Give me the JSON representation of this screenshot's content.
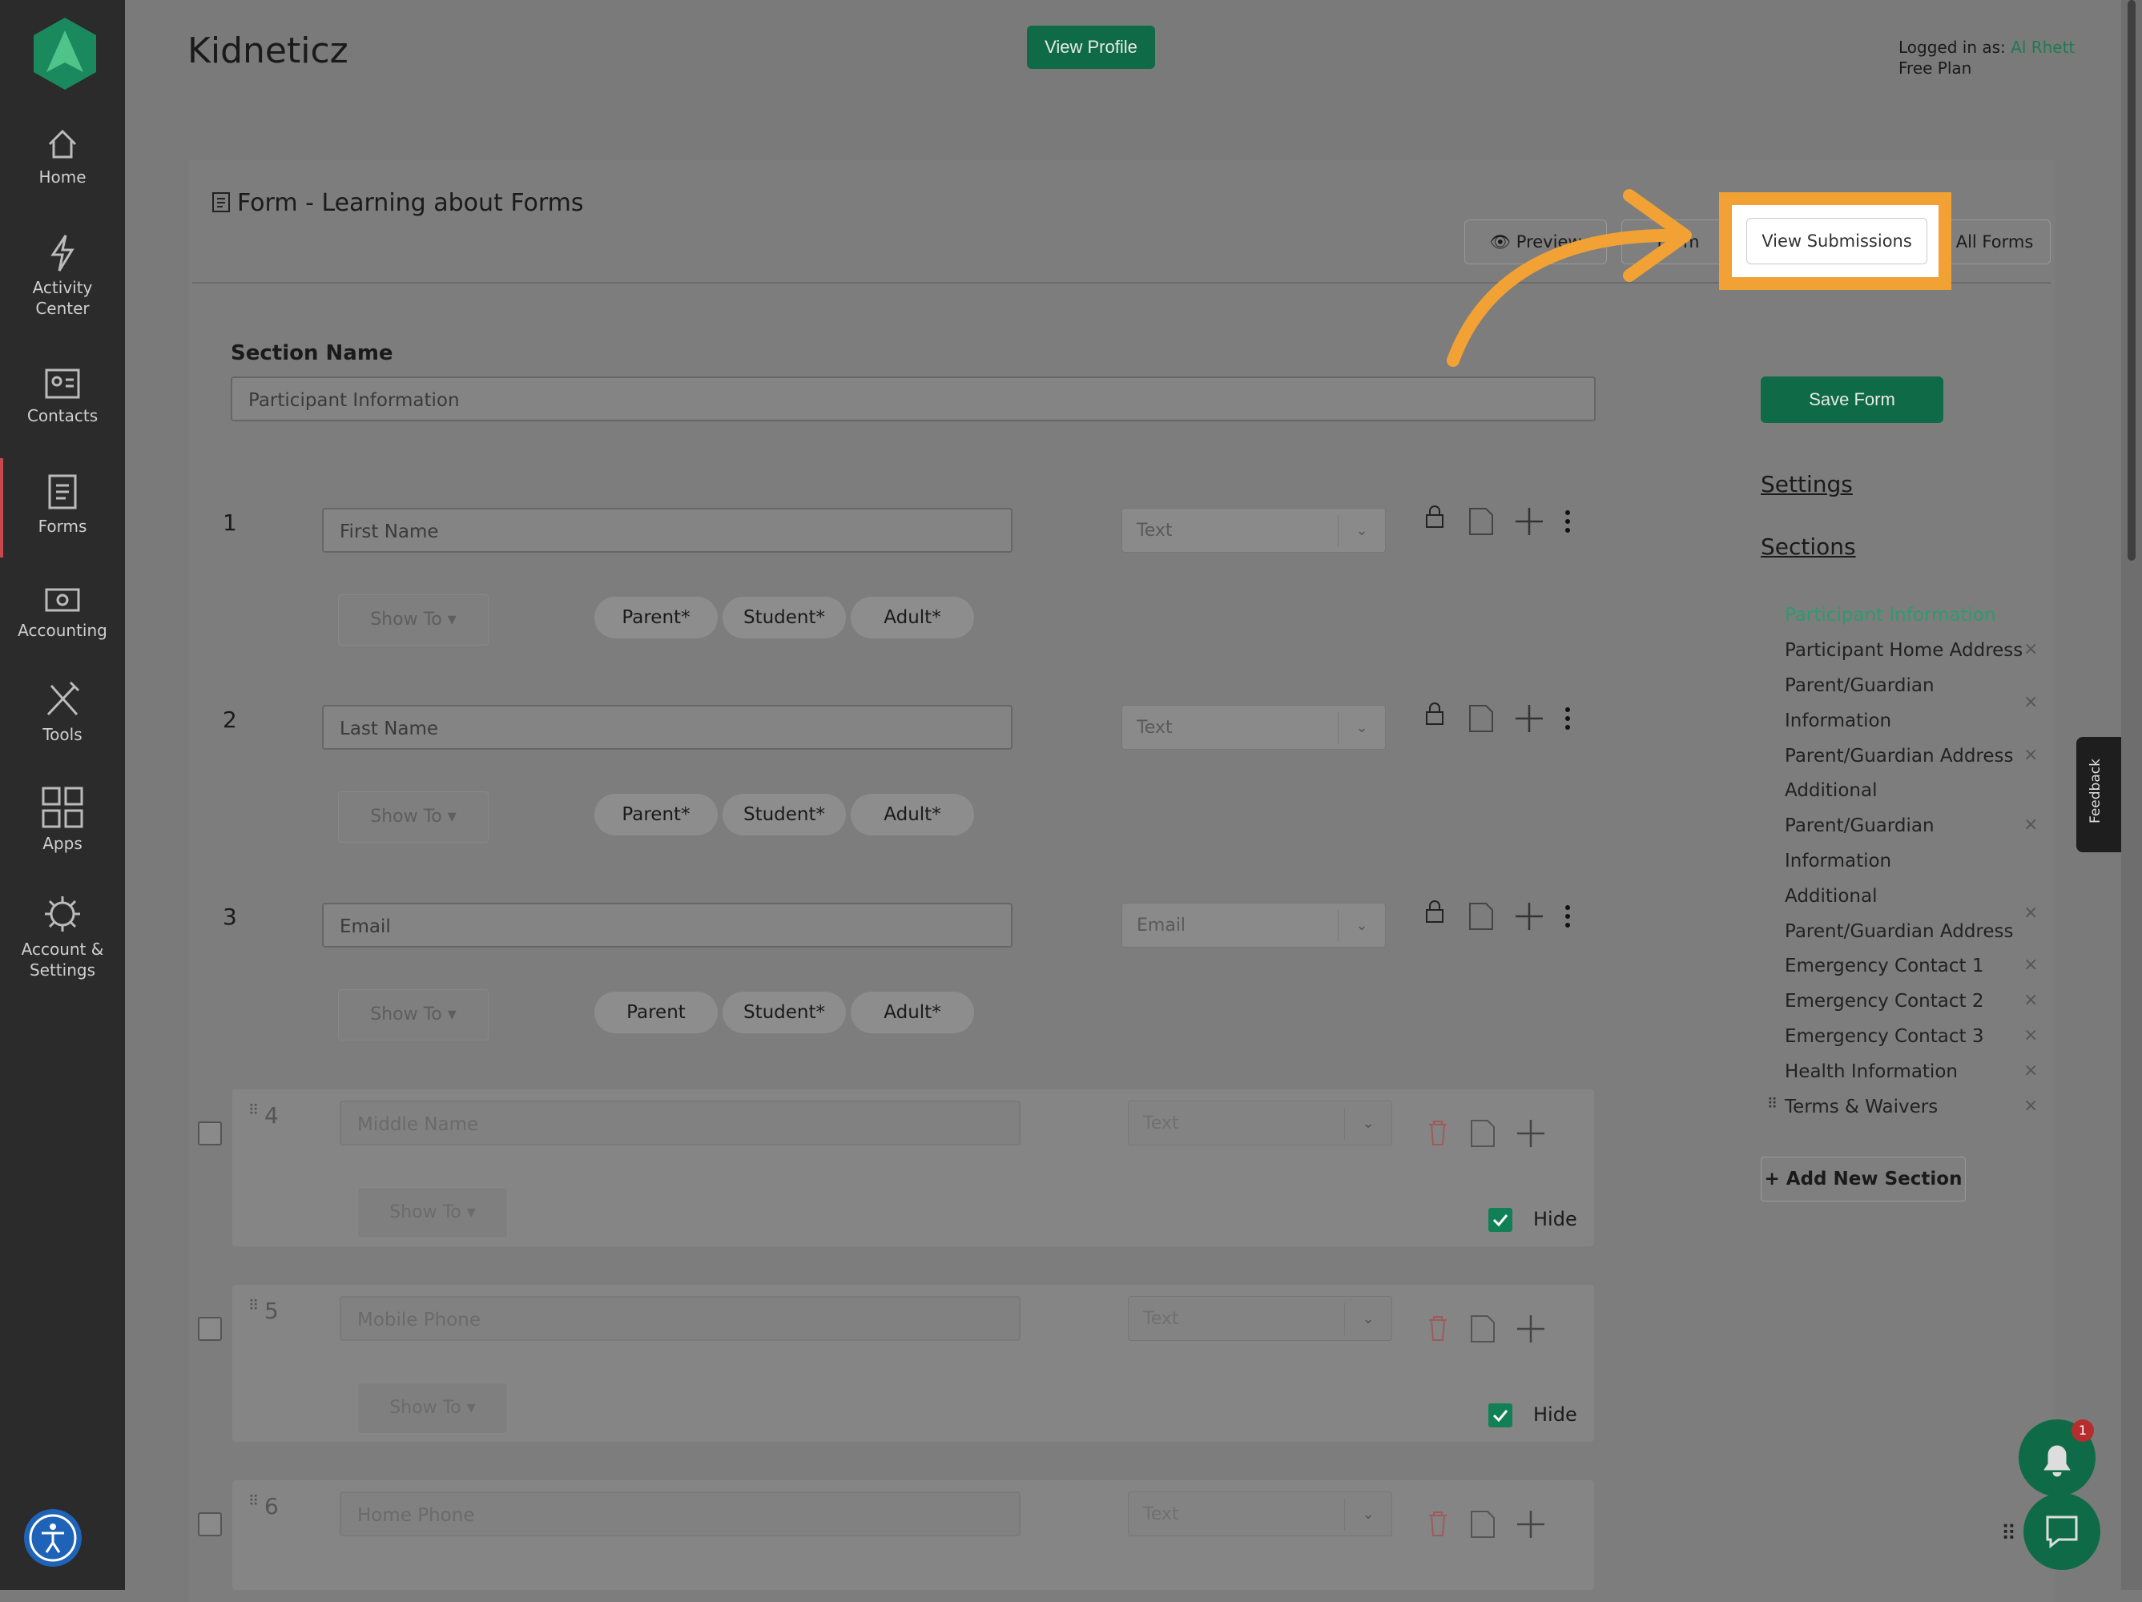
{
  "app": {
    "title": "Kidneticz",
    "view_profile": "View Profile",
    "logged_in_prefix": "Logged in as:",
    "user": "Al Rhett",
    "plan": "Free Plan"
  },
  "nav": [
    {
      "label": "Home",
      "icon": "home-icon"
    },
    {
      "label": "Activity Center",
      "icon": "lightning-icon"
    },
    {
      "label": "Contacts",
      "icon": "contacts-icon"
    },
    {
      "label": "Forms",
      "icon": "clipboard-icon"
    },
    {
      "label": "Accounting",
      "icon": "money-icon"
    },
    {
      "label": "Tools",
      "icon": "tools-icon"
    },
    {
      "label": "Apps",
      "icon": "grid-icon"
    },
    {
      "label": "Account & Settings",
      "icon": "gear-icon"
    }
  ],
  "form": {
    "title": "Form - Learning about Forms",
    "toolbar": {
      "preview": "Preview",
      "form": "Form",
      "view_submissions": "View Submissions",
      "all_forms": "All Forms"
    },
    "section_name_label": "Section Name",
    "section_name_value": "Participant Information",
    "save": "Save Form",
    "fields": [
      {
        "num": "1",
        "name": "First Name",
        "type": "Text",
        "show_to": "Show To",
        "pills": [
          "Parent*",
          "Student*",
          "Adult*"
        ]
      },
      {
        "num": "2",
        "name": "Last Name",
        "type": "Text",
        "show_to": "Show To",
        "pills": [
          "Parent*",
          "Student*",
          "Adult*"
        ]
      },
      {
        "num": "3",
        "name": "Email",
        "type": "Email",
        "show_to": "Show To",
        "pills": [
          "Parent",
          "Student*",
          "Adult*"
        ]
      }
    ],
    "hidden_fields": [
      {
        "num": "4",
        "placeholder": "Middle Name",
        "type": "Text",
        "show_to": "Show To",
        "hide_label": "Hide",
        "hidden": true
      },
      {
        "num": "5",
        "placeholder": "Mobile Phone",
        "type": "Text",
        "show_to": "Show To",
        "hide_label": "Hide",
        "hidden": true
      },
      {
        "num": "6",
        "placeholder": "Home Phone",
        "type": "Text"
      }
    ]
  },
  "right_panel": {
    "settings": "Settings",
    "sections_title": "Sections",
    "sections": [
      "Participant Information",
      "Participant Home Address",
      "Parent/Guardian",
      "Information",
      "Parent/Guardian Address",
      "Additional",
      "Parent/Guardian",
      "Information",
      "Additional",
      "Parent/Guardian Address",
      "Emergency Contact 1",
      "Emergency Contact 2",
      "Emergency Contact 3",
      "Health Information",
      "Terms & Waivers"
    ],
    "close_glyph": "×",
    "add_section": "+ Add New Section"
  },
  "feedback": "Feedback",
  "notification_count": "1",
  "colors": {
    "brand_green": "#0f6b47",
    "active_section": "#2f9a6e",
    "highlight_orange": "#f2a234",
    "sidebar_bg": "#2b2b2b"
  }
}
